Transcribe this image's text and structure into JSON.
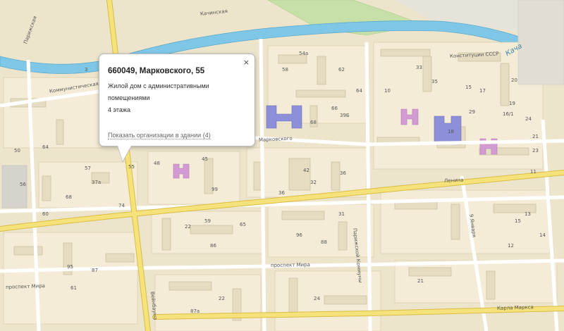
{
  "popup": {
    "title": "660049, Марковского, 55",
    "description": "Жилой дом с административными помещениями",
    "floors": "4 этажа",
    "link": "Показать организации в здании (4)",
    "close": "×"
  },
  "streets": {
    "kachinskaya": "Качинская",
    "kommunisticheskaya": "Коммунистическая",
    "konstitutsii": "Конституции СССР",
    "kacha": "Кача",
    "markovskogo": "Марковского",
    "lenina": "Ленина",
    "parizhskoy_kommuny": "Парижской Коммуны",
    "yanvarya": "9 Января",
    "prospekt_mira_center": "проспект Мира",
    "prospekt_mira_left": "проспект Мира",
    "veinbauma": "Вейнбаума",
    "karla_marksa": "Карла Маркса",
    "parizhskaya_top": "Парижская"
  },
  "house_numbers": [
    "54а",
    "58",
    "62",
    "64",
    "66",
    "68",
    "33",
    "35",
    "17",
    "18",
    "19",
    "21",
    "23",
    "15",
    "16/1",
    "20",
    "10",
    "39Б",
    "29",
    "24",
    "57",
    "55",
    "48",
    "45",
    "42",
    "32",
    "36",
    "36",
    "37а",
    "74",
    "68",
    "22",
    "86",
    "95",
    "59",
    "65",
    "87",
    "22",
    "31",
    "24",
    "21",
    "61",
    "99",
    "87а",
    "96",
    "88",
    "11",
    "13",
    "15",
    "14",
    "12",
    "60",
    "3",
    "56",
    "50",
    "64"
  ],
  "colors": {
    "water": "#7fc7e6",
    "park": "#c6e0a7",
    "block": "#f4ecd6",
    "building": "#e5dcc2",
    "building_edge": "#c9bc9c",
    "major_road": "#f6e27a",
    "major_road_edge": "#d8bd45",
    "admin_building": "#8d90d8",
    "school_building": "#d39bd3"
  }
}
